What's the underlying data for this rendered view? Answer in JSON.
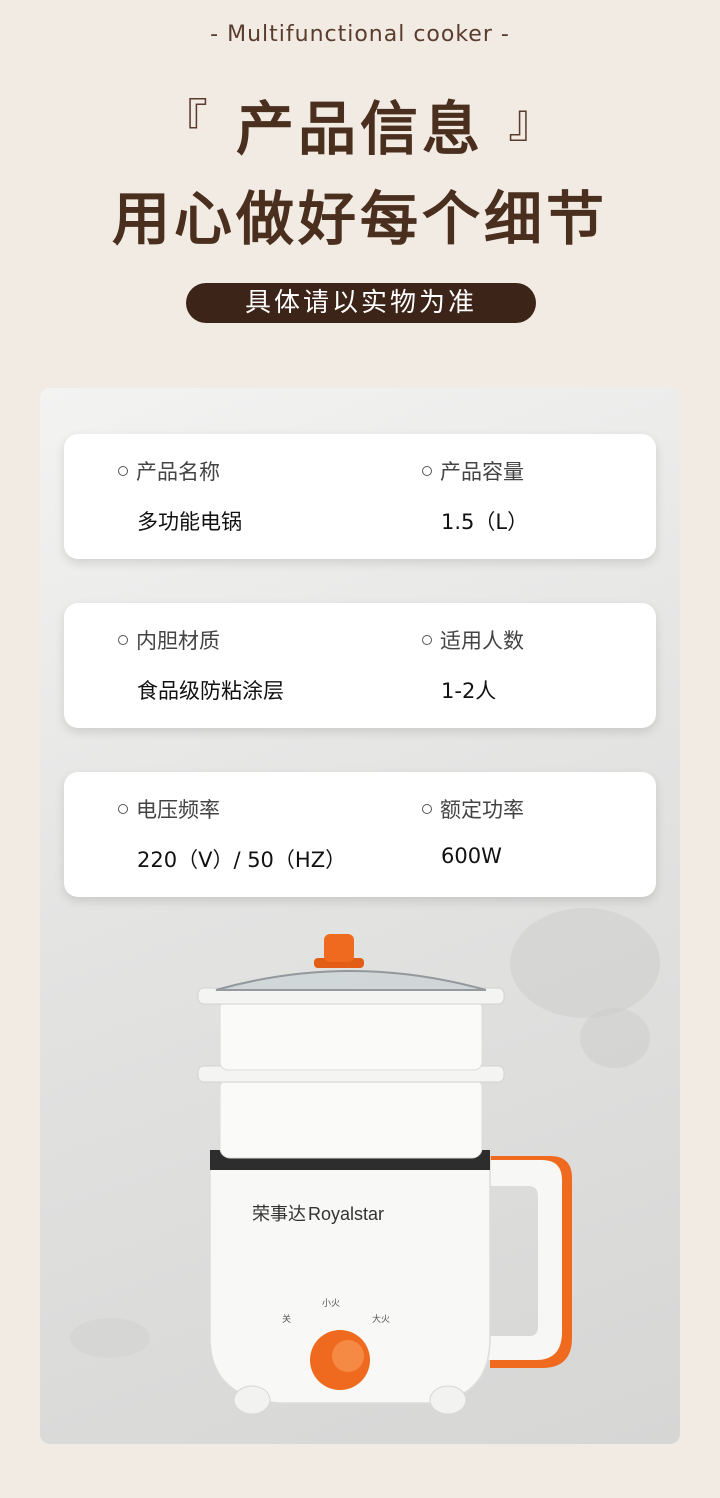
{
  "header": {
    "subtitle": "- Multifunctional cooker -",
    "title": "产品信息",
    "bracket_left": "『",
    "bracket_right": "』",
    "headline": "用心做好每个细节",
    "note": "具体请以实物为准"
  },
  "specs": [
    {
      "label": "产品名称",
      "value": "多功能电锅"
    },
    {
      "label": "产品容量",
      "value": "1.5（L）"
    },
    {
      "label": "内胆材质",
      "value": "食品级防粘涂层"
    },
    {
      "label": "适用人数",
      "value": "1-2人"
    },
    {
      "label": "电压频率",
      "value": "220（V）/ 50（HZ）"
    },
    {
      "label": "额定功率",
      "value": "600W"
    }
  ],
  "product": {
    "brand_cn": "荣事达",
    "brand_en": "Royalstar",
    "dial_small": "小火",
    "dial_big": "大火",
    "dial_off": "关"
  },
  "colors": {
    "brown": "#4a2f1f",
    "pill": "#3d2418",
    "orange": "#ef6a1f"
  }
}
